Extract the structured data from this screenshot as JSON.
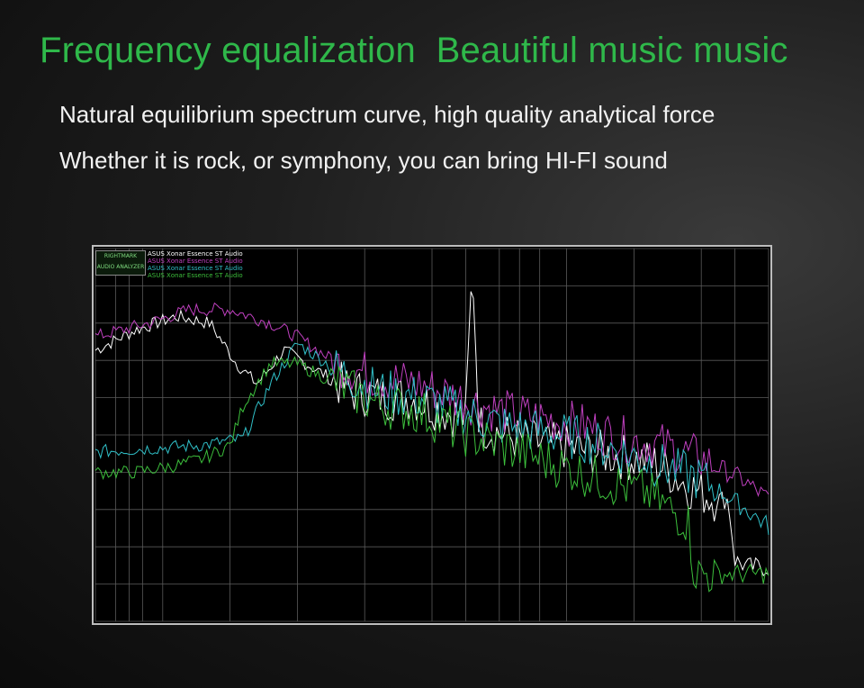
{
  "headline": "Frequency equalization  Beautiful music music",
  "line1": "Natural equilibrium spectrum curve, high quality analytical force",
  "line2": "Whether it is rock, or symphony, you can bring HI-FI sound",
  "logo_text": "RIGHTMARK AUDIO ANALYZER",
  "colors": {
    "headline": "#2fb84a",
    "text": "#f2f2f2",
    "grid": "#5a5a5a"
  },
  "chart_data": {
    "type": "line",
    "legend": [
      "ASUS Xonar Essence ST Audio",
      "ASUS Xonar Essence ST Audio",
      "ASUS Xonar Essence ST Audio",
      "ASUS Xonar Essence ST Audio"
    ],
    "grid": true,
    "legend_position": "top-left",
    "series": [
      {
        "name": "ASUS Xonar Essence ST Audio",
        "color": "#ffffff",
        "x": [
          0.0,
          0.06,
          0.12,
          0.17,
          0.21,
          0.24,
          0.28,
          0.33,
          0.38,
          0.43,
          0.47,
          0.52,
          0.55,
          0.56,
          0.57,
          0.62,
          0.68,
          0.74,
          0.8,
          0.84,
          0.88,
          0.92,
          0.94,
          0.95,
          0.97,
          1.0
        ],
        "y": [
          -30,
          -24,
          -20,
          -22,
          -34,
          -40,
          -30,
          -36,
          -42,
          -44,
          -44,
          -48,
          -50,
          -4,
          -52,
          -56,
          -58,
          -60,
          -62,
          -64,
          -70,
          -74,
          -74,
          -92,
          -94,
          -94
        ]
      },
      {
        "name": "ASUS Xonar Essence ST Audio",
        "color": "#c040c0",
        "x": [
          0.0,
          0.08,
          0.14,
          0.2,
          0.26,
          0.3,
          0.36,
          0.42,
          0.48,
          0.54,
          0.6,
          0.66,
          0.72,
          0.78,
          0.84,
          0.9,
          0.96,
          1.0
        ],
        "y": [
          -26,
          -22,
          -18,
          -18,
          -22,
          -26,
          -34,
          -38,
          -40,
          -44,
          -48,
          -50,
          -52,
          -56,
          -58,
          -62,
          -68,
          -74
        ]
      },
      {
        "name": "ASUS Xonar Essence ST Audio",
        "color": "#30c0c8",
        "x": [
          0.0,
          0.16,
          0.22,
          0.26,
          0.3,
          0.36,
          0.42,
          0.48,
          0.54,
          0.6,
          0.66,
          0.72,
          0.78,
          0.84,
          0.9,
          0.96,
          1.0
        ],
        "y": [
          -60,
          -58,
          -56,
          -40,
          -28,
          -36,
          -42,
          -44,
          -48,
          -52,
          -54,
          -56,
          -60,
          -64,
          -68,
          -76,
          -82
        ]
      },
      {
        "name": "ASUS Xonar Essence ST Audio",
        "color": "#3cbf3c",
        "x": [
          0.0,
          0.06,
          0.12,
          0.16,
          0.2,
          0.22,
          0.26,
          0.3,
          0.36,
          0.42,
          0.48,
          0.54,
          0.6,
          0.66,
          0.72,
          0.78,
          0.82,
          0.86,
          0.88,
          0.89,
          0.91,
          0.95,
          1.0
        ],
        "y": [
          -66,
          -66,
          -64,
          -62,
          -58,
          -46,
          -34,
          -34,
          -40,
          -46,
          -48,
          -54,
          -58,
          -62,
          -66,
          -70,
          -72,
          -78,
          -80,
          -96,
          -96,
          -96,
          -96
        ]
      }
    ],
    "ylim": [
      -110,
      0
    ]
  }
}
